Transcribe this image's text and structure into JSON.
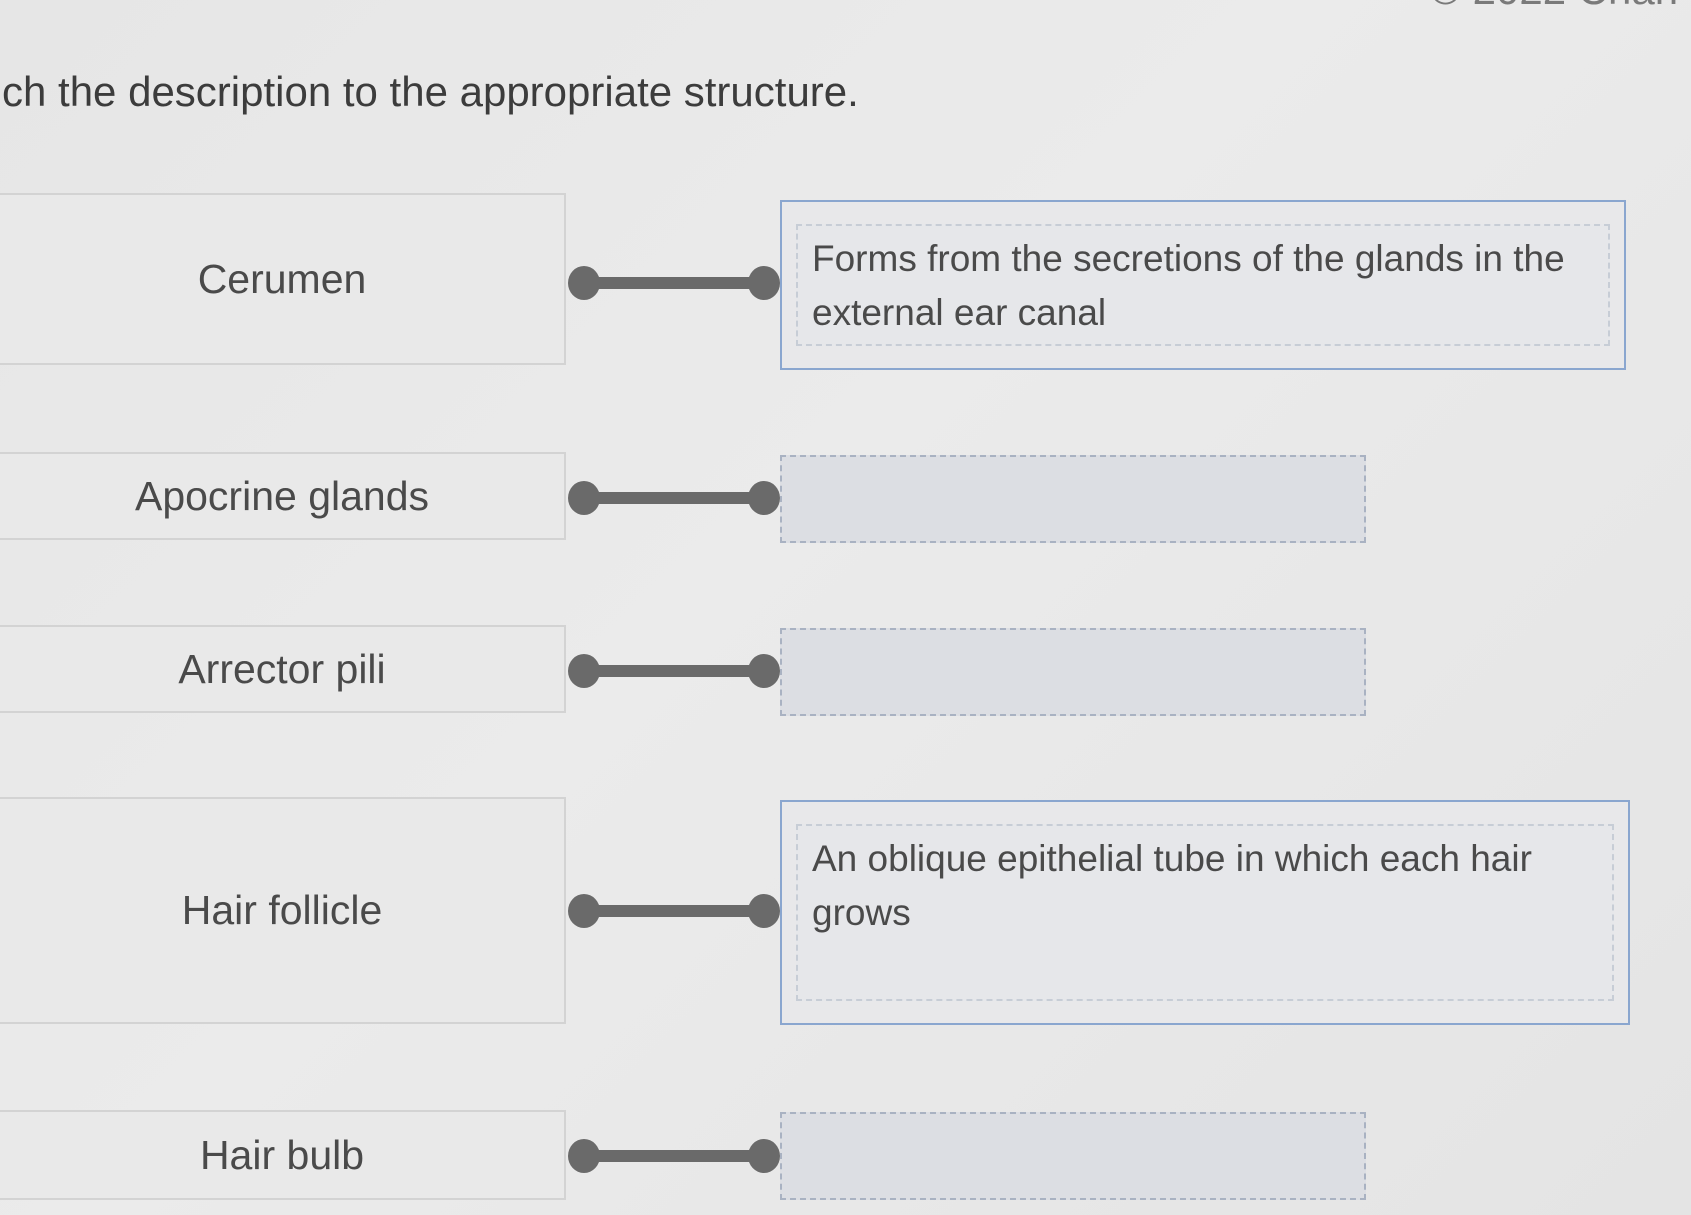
{
  "header": {
    "instruction": "ch the description to the appropriate structure.",
    "corner_fragment": "© 2022 Chan"
  },
  "terms": [
    {
      "label": "Cerumen"
    },
    {
      "label": "Apocrine glands"
    },
    {
      "label": "Arrector pili"
    },
    {
      "label": "Hair follicle"
    },
    {
      "label": "Hair bulb"
    }
  ],
  "answers": [
    {
      "text": "Forms from the secretions of the glands in the external ear canal"
    },
    {
      "text": ""
    },
    {
      "text": ""
    },
    {
      "text": "An oblique epithelial tube in which each hair grows"
    },
    {
      "text": ""
    }
  ]
}
